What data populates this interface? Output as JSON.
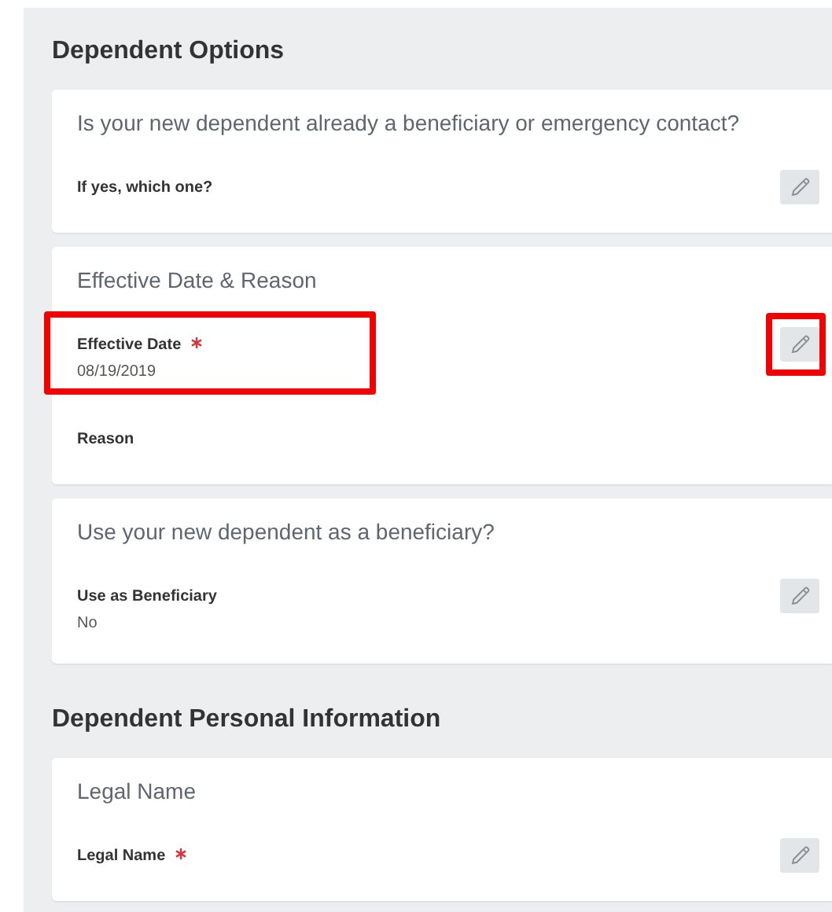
{
  "sections": [
    {
      "heading": "Dependent Options",
      "cards": [
        {
          "title": "Is your new dependent already a beneficiary or emergency contact?",
          "edit_highlighted": false,
          "fields": [
            {
              "label": "If yes, which one?",
              "required": false,
              "highlighted": false
            }
          ]
        },
        {
          "title": "Effective Date & Reason",
          "edit_highlighted": true,
          "fields": [
            {
              "label": "Effective Date",
              "required": true,
              "value": "08/19/2019",
              "highlighted": true
            },
            {
              "label": "Reason",
              "required": false,
              "highlighted": false
            }
          ]
        },
        {
          "title": "Use your new dependent as a beneficiary?",
          "edit_highlighted": false,
          "fields": [
            {
              "label": "Use as Beneficiary",
              "required": false,
              "value": "No",
              "highlighted": false
            }
          ]
        }
      ]
    },
    {
      "heading": "Dependent Personal Information",
      "cards": [
        {
          "title": "Legal Name",
          "edit_highlighted": false,
          "fields": [
            {
              "label": "Legal Name",
              "required": true,
              "highlighted": false
            }
          ]
        }
      ]
    }
  ]
}
